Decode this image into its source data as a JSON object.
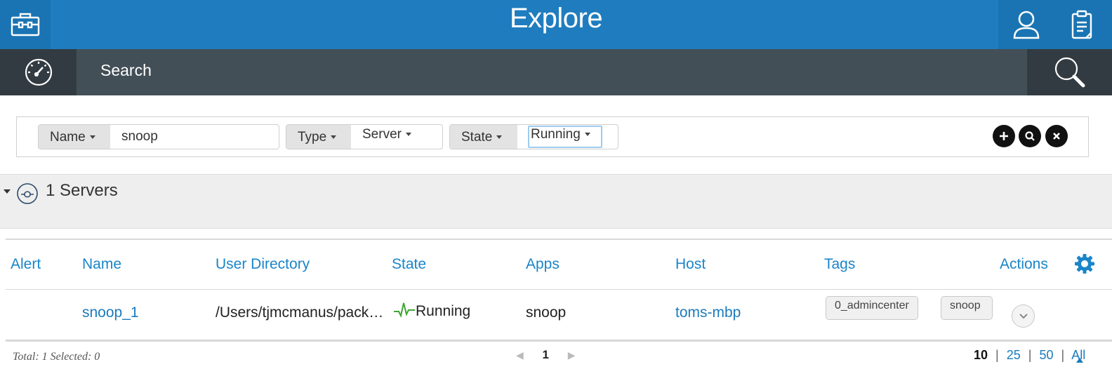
{
  "header": {
    "title": "Explore"
  },
  "subnav": {
    "label": "Search"
  },
  "filters": [
    {
      "key": "Name",
      "value": "snoop"
    },
    {
      "key": "Type",
      "value": "Server"
    },
    {
      "key": "State",
      "value": "Running"
    }
  ],
  "group": {
    "count_label": "1 Servers"
  },
  "table": {
    "columns": [
      "Alert",
      "Name",
      "User Directory",
      "State",
      "Apps",
      "Host",
      "Tags",
      "Actions"
    ],
    "rows": [
      {
        "alert": "",
        "name": "snoop_1",
        "user_directory": "/Users/tjmcmanus/pack…",
        "state": "Running",
        "apps": "snoop",
        "host": "toms-mbp",
        "tags": [
          "0_admincenter",
          "snoop"
        ]
      }
    ]
  },
  "footer": {
    "total_text": "Total: 1 Selected: 0",
    "page": "1",
    "sizes": [
      "10",
      "25",
      "50",
      "All"
    ],
    "separator": "|"
  },
  "colors": {
    "header": "#1f7dbf",
    "subnav": "#434f57",
    "link": "#1a7bbd",
    "running": "#3fa535"
  }
}
